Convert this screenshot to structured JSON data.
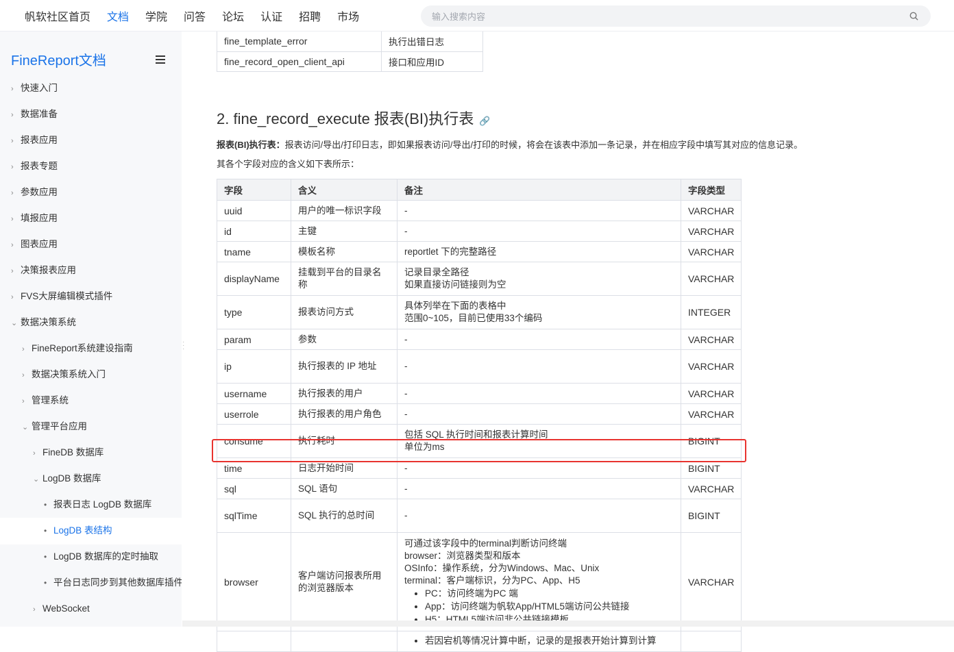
{
  "topnav": {
    "items": [
      "帆软社区首页",
      "文档",
      "学院",
      "问答",
      "论坛",
      "认证",
      "招聘",
      "市场"
    ],
    "active": "文档",
    "search_placeholder": "输入搜索内容"
  },
  "sidebar": {
    "title": "FineReport文档",
    "items": [
      {
        "label": "快速入门",
        "level": 0,
        "state": "collapsed"
      },
      {
        "label": "数据准备",
        "level": 0,
        "state": "collapsed"
      },
      {
        "label": "报表应用",
        "level": 0,
        "state": "collapsed"
      },
      {
        "label": "报表专题",
        "level": 0,
        "state": "collapsed"
      },
      {
        "label": "参数应用",
        "level": 0,
        "state": "collapsed"
      },
      {
        "label": "填报应用",
        "level": 0,
        "state": "collapsed"
      },
      {
        "label": "图表应用",
        "level": 0,
        "state": "collapsed"
      },
      {
        "label": "决策报表应用",
        "level": 0,
        "state": "collapsed"
      },
      {
        "label": "FVS大屏编辑模式插件",
        "level": 0,
        "state": "collapsed"
      },
      {
        "label": "数据决策系统",
        "level": 0,
        "state": "expanded"
      },
      {
        "label": "FineReport系统建设指南",
        "level": 1,
        "state": "collapsed"
      },
      {
        "label": "数据决策系统入门",
        "level": 1,
        "state": "collapsed"
      },
      {
        "label": "管理系统",
        "level": 1,
        "state": "collapsed"
      },
      {
        "label": "管理平台应用",
        "level": 1,
        "state": "expanded"
      },
      {
        "label": "FineDB 数据库",
        "level": 2,
        "state": "collapsed"
      },
      {
        "label": "LogDB 数据库",
        "level": 2,
        "state": "expanded"
      },
      {
        "label": "报表日志 LogDB 数据库",
        "level": 3,
        "state": "leaf"
      },
      {
        "label": "LogDB 表结构",
        "level": 3,
        "state": "leaf-selected"
      },
      {
        "label": "LogDB 数据库的定时抽取",
        "level": 3,
        "state": "leaf"
      },
      {
        "label": "平台日志同步到其他数据库插件",
        "level": 3,
        "state": "leaf"
      },
      {
        "label": "WebSocket",
        "level": 2,
        "state": "collapsed"
      }
    ]
  },
  "top_table": {
    "rows": [
      [
        "fine_template_error",
        "执行出错日志"
      ],
      [
        "fine_record_open_client_api",
        "接口和应用ID"
      ]
    ]
  },
  "section": {
    "heading": "2. fine_record_execute 报表(BI)执行表",
    "desc_bold": "报表(BI)执行表：",
    "desc_rest": "报表访问/导出/打印日志，即如果报表访问/导出/打印的时候，将会在该表中添加一条记录，并在相应字段中填写其对应的信息记录。",
    "desc2": "其各个字段对应的含义如下表所示："
  },
  "fields_table": {
    "headers": [
      "字段",
      "含义",
      "备注",
      "字段类型"
    ],
    "rows": [
      {
        "field": "uuid",
        "meaning": "用户的唯一标识字段",
        "note": [
          "-"
        ],
        "type": "VARCHAR"
      },
      {
        "field": "id",
        "meaning": "主键",
        "note": [
          "-"
        ],
        "type": "VARCHAR"
      },
      {
        "field": "tname",
        "meaning": "模板名称",
        "note": [
          "reportlet 下的完整路径"
        ],
        "type": "VARCHAR"
      },
      {
        "field": "displayName",
        "meaning": "挂载到平台的目录名称",
        "note": [
          "记录目录全路径",
          "如果直接访问链接则为空"
        ],
        "type": "VARCHAR"
      },
      {
        "field": "type",
        "meaning": "报表访问方式",
        "note": [
          "具体列举在下面的表格中",
          "范围0~105，目前已使用33个编码"
        ],
        "type": "INTEGER"
      },
      {
        "field": "param",
        "meaning": "参数",
        "note": [
          "-"
        ],
        "type": "VARCHAR"
      },
      {
        "field": "ip",
        "meaning": "执行报表的 IP 地址",
        "note": [
          "-"
        ],
        "type": "VARCHAR"
      },
      {
        "field": "username",
        "meaning": "执行报表的用户",
        "note": [
          "-"
        ],
        "type": "VARCHAR"
      },
      {
        "field": "userrole",
        "meaning": "执行报表的用户角色",
        "note": [
          "-"
        ],
        "type": "VARCHAR"
      },
      {
        "field": "consume",
        "meaning": "执行耗时",
        "note": [
          "包括 SQL 执行时间和报表计算时间",
          "单位为ms"
        ],
        "type": "BIGINT"
      },
      {
        "field": "time",
        "meaning": "日志开始时间",
        "note": [
          "-"
        ],
        "type": "BIGINT"
      },
      {
        "field": "sql",
        "meaning": "SQL 语句",
        "note": [
          "-"
        ],
        "type": "VARCHAR"
      },
      {
        "field": "sqlTime",
        "meaning": "SQL 执行的总时间",
        "note": [
          "-"
        ],
        "type": "BIGINT"
      }
    ],
    "browser_row": {
      "field": "browser",
      "meaning": "客户端访问报表所用的浏览器版本",
      "lines": [
        "可通过该字段中的terminal判断访问终端",
        "browser：浏览器类型和版本",
        "OSInfo：操作系统，分为Windows、Mac、Unix",
        "terminal：客户端标识，分为PC、App、H5"
      ],
      "bullets": [
        "PC：访问终端为PC 端",
        "App：访问终端为帆软App/HTML5端访问公共链接",
        "H5：HTML5端访问非公共链接模板"
      ],
      "type": "VARCHAR"
    },
    "last_row_bullet": "若因宕机等情况计算中断，记录的是报表开始计算到计算"
  },
  "colors": {
    "accent": "#1a73e8",
    "highlight": "#e8332f"
  }
}
